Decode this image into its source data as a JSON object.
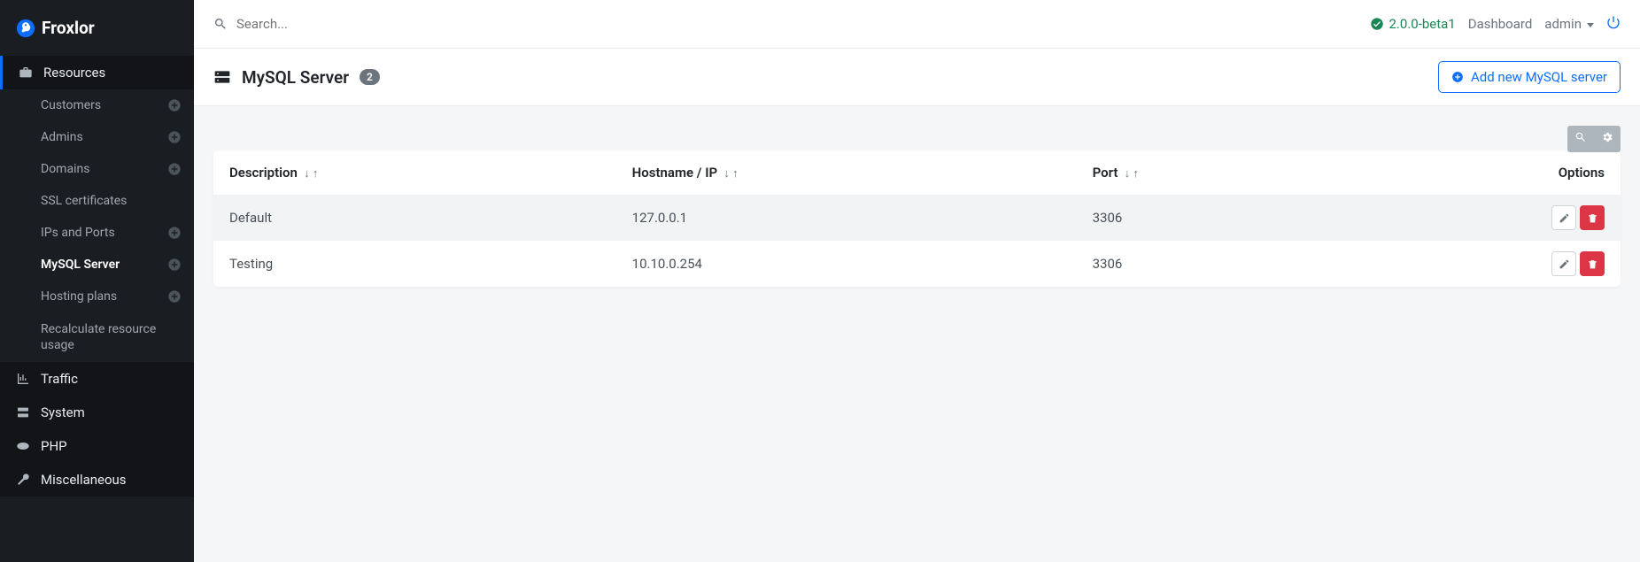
{
  "brand": "Froxlor",
  "search": {
    "placeholder": "Search..."
  },
  "topbar": {
    "version": "2.0.0-beta1",
    "dashboard": "Dashboard",
    "user": "admin"
  },
  "sidebar": {
    "resources": {
      "label": "Resources",
      "items": [
        {
          "label": "Customers",
          "plus": true,
          "active": false
        },
        {
          "label": "Admins",
          "plus": true,
          "active": false
        },
        {
          "label": "Domains",
          "plus": true,
          "active": false
        },
        {
          "label": "SSL certificates",
          "plus": false,
          "active": false
        },
        {
          "label": "IPs and Ports",
          "plus": true,
          "active": false
        },
        {
          "label": "MySQL Server",
          "plus": true,
          "active": true
        },
        {
          "label": "Hosting plans",
          "plus": true,
          "active": false
        },
        {
          "label": "Recalculate resource usage",
          "plus": false,
          "active": false,
          "wrap": true
        }
      ]
    },
    "traffic": "Traffic",
    "system": "System",
    "php": "PHP",
    "misc": "Miscellaneous"
  },
  "page": {
    "title": "MySQL Server",
    "count": "2",
    "add_label": "Add new MySQL server"
  },
  "table": {
    "columns": {
      "desc": "Description",
      "host": "Hostname / IP",
      "port": "Port",
      "options": "Options"
    },
    "rows": [
      {
        "desc": "Default",
        "host": "127.0.0.1",
        "port": "3306"
      },
      {
        "desc": "Testing",
        "host": "10.10.0.254",
        "port": "3306"
      }
    ]
  }
}
